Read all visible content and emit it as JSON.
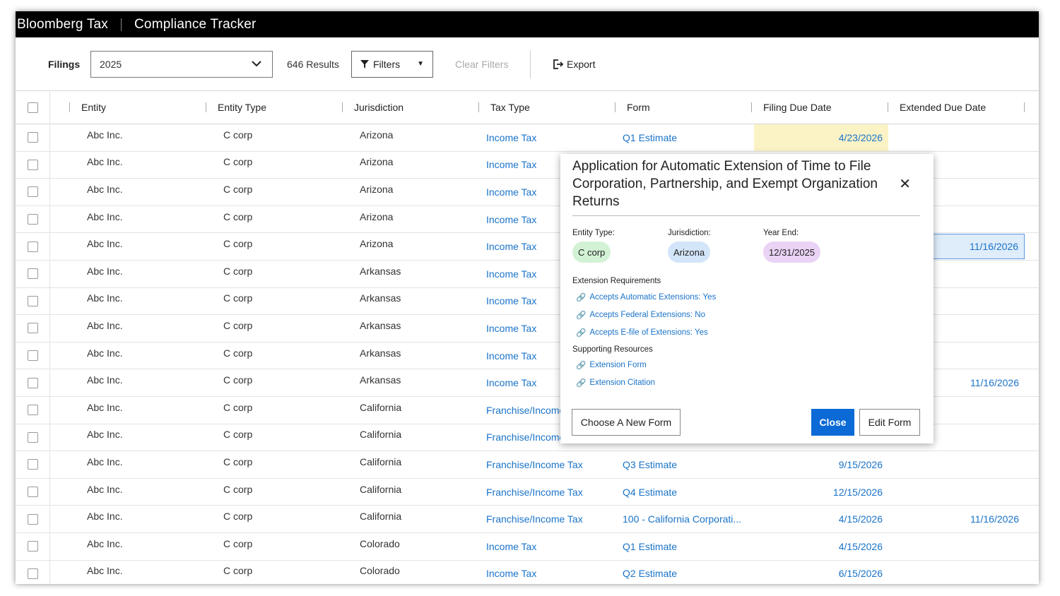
{
  "header": {
    "brand": "Bloomberg Tax",
    "app": "Compliance Tracker"
  },
  "toolbar": {
    "filings_label": "Filings",
    "year_value": "2025",
    "results": "646 Results",
    "filters_label": "Filters",
    "clear_label": "Clear Filters",
    "export_label": "Export"
  },
  "columns": [
    "Entity",
    "Entity Type",
    "Jurisdiction",
    "Tax Type",
    "Form",
    "Filing Due Date",
    "Extended Due Date"
  ],
  "rows": [
    {
      "entity": "Abc Inc.",
      "type": "C corp",
      "jurisdiction": "Arizona",
      "tax": "Income Tax",
      "form": "Q1 Estimate",
      "due": "4/23/2026",
      "ext": ""
    },
    {
      "entity": "Abc Inc.",
      "type": "C corp",
      "jurisdiction": "Arizona",
      "tax": "Income Tax",
      "form": "",
      "due": "",
      "ext": ""
    },
    {
      "entity": "Abc Inc.",
      "type": "C corp",
      "jurisdiction": "Arizona",
      "tax": "Income Tax",
      "form": "",
      "due": "",
      "ext": ""
    },
    {
      "entity": "Abc Inc.",
      "type": "C corp",
      "jurisdiction": "Arizona",
      "tax": "Income Tax",
      "form": "",
      "due": "",
      "ext": ""
    },
    {
      "entity": "Abc Inc.",
      "type": "C corp",
      "jurisdiction": "Arizona",
      "tax": "Income Tax",
      "form": "",
      "due": "",
      "ext": "11/16/2026"
    },
    {
      "entity": "Abc Inc.",
      "type": "C corp",
      "jurisdiction": "Arkansas",
      "tax": "Income Tax",
      "form": "",
      "due": "",
      "ext": ""
    },
    {
      "entity": "Abc Inc.",
      "type": "C corp",
      "jurisdiction": "Arkansas",
      "tax": "Income Tax",
      "form": "",
      "due": "",
      "ext": ""
    },
    {
      "entity": "Abc Inc.",
      "type": "C corp",
      "jurisdiction": "Arkansas",
      "tax": "Income Tax",
      "form": "",
      "due": "",
      "ext": ""
    },
    {
      "entity": "Abc Inc.",
      "type": "C corp",
      "jurisdiction": "Arkansas",
      "tax": "Income Tax",
      "form": "",
      "due": "",
      "ext": ""
    },
    {
      "entity": "Abc Inc.",
      "type": "C corp",
      "jurisdiction": "Arkansas",
      "tax": "Income Tax",
      "form": "",
      "due": "",
      "ext": "11/16/2026"
    },
    {
      "entity": "Abc Inc.",
      "type": "C corp",
      "jurisdiction": "California",
      "tax": "Franchise/Income Tax",
      "form": "",
      "due": "",
      "ext": ""
    },
    {
      "entity": "Abc Inc.",
      "type": "C corp",
      "jurisdiction": "California",
      "tax": "Franchise/Income Tax",
      "form": "",
      "due": "",
      "ext": ""
    },
    {
      "entity": "Abc Inc.",
      "type": "C corp",
      "jurisdiction": "California",
      "tax": "Franchise/Income Tax",
      "form": "Q3 Estimate",
      "due": "9/15/2026",
      "ext": ""
    },
    {
      "entity": "Abc Inc.",
      "type": "C corp",
      "jurisdiction": "California",
      "tax": "Franchise/Income Tax",
      "form": "Q4 Estimate",
      "due": "12/15/2026",
      "ext": ""
    },
    {
      "entity": "Abc Inc.",
      "type": "C corp",
      "jurisdiction": "California",
      "tax": "Franchise/Income Tax",
      "form": "100 - California Corporati...",
      "due": "4/15/2026",
      "ext": "11/16/2026"
    },
    {
      "entity": "Abc Inc.",
      "type": "C corp",
      "jurisdiction": "Colorado",
      "tax": "Income Tax",
      "form": "Q1 Estimate",
      "due": "4/15/2026",
      "ext": ""
    },
    {
      "entity": "Abc Inc.",
      "type": "C corp",
      "jurisdiction": "Colorado",
      "tax": "Income Tax",
      "form": "Q2 Estimate",
      "due": "6/15/2026",
      "ext": ""
    }
  ],
  "modal": {
    "title": "Application for Automatic Extension of Time to File Corporation, Partnership, and Exempt Organization Returns",
    "entity_type_label": "Entity Type:",
    "entity_type": "C corp",
    "jurisdiction_label": "Jurisdiction:",
    "jurisdiction": "Arizona",
    "year_end_label": "Year End:",
    "year_end": "12/31/2025",
    "ext_req_label": "Extension Requirements",
    "req_links": [
      "Accepts Automatic Extensions: Yes",
      "Accepts Federal Extensions: No",
      "Accepts E-file of Extensions: Yes"
    ],
    "support_label": "Supporting Resources",
    "support_links": [
      "Extension Form",
      "Extension Citation"
    ],
    "choose_btn": "Choose A New Form",
    "close_btn": "Close",
    "edit_btn": "Edit Form"
  },
  "colors": {
    "accent": "#0b6ad6",
    "link": "#1a73c8",
    "pill_green": "#d3f2d5",
    "pill_blue": "#d3e5f8",
    "pill_purple": "#ead3f5",
    "highlight_yellow": "#fbf3c6"
  }
}
